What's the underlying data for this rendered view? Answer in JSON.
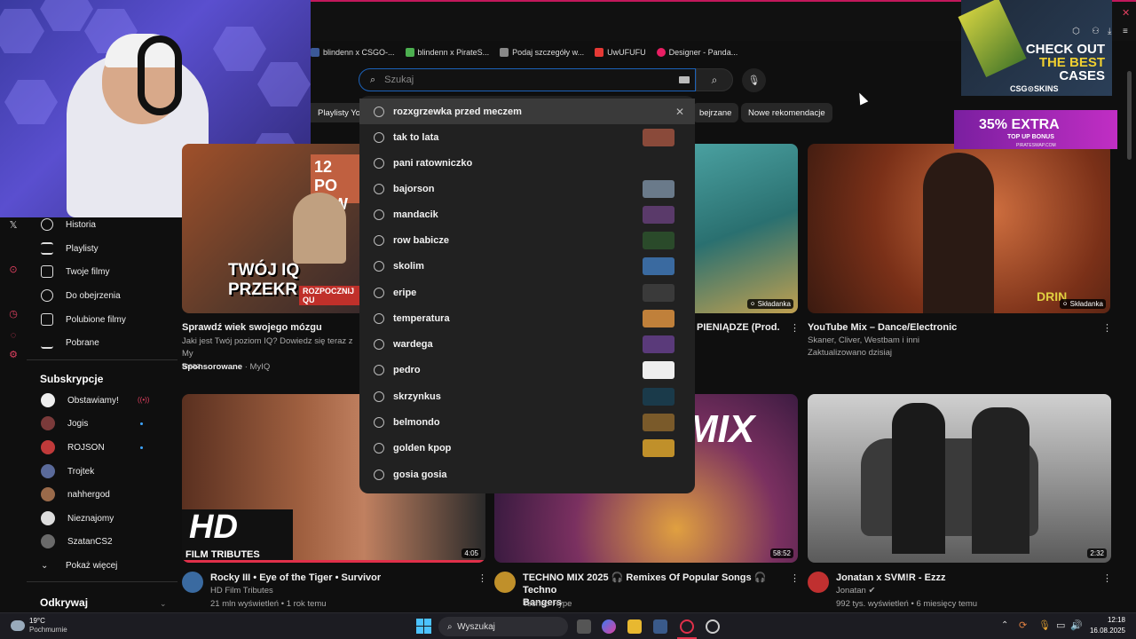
{
  "bookmarks": [
    {
      "label": "blindenn x CSGO-...",
      "color": "#3b5998"
    },
    {
      "label": "blindenn x PirateS...",
      "color": "#4caf50"
    },
    {
      "label": "Podaj szczegóły w...",
      "color": "#888888"
    },
    {
      "label": "UwUFUFU",
      "color": "#e53935"
    },
    {
      "label": "Designer - Panda...",
      "color": "#e91e63"
    }
  ],
  "search": {
    "placeholder": "Szukaj"
  },
  "suggestions": [
    {
      "text": "rozxgrzewka przed meczem",
      "thumb": null
    },
    {
      "text": "tak to lata",
      "thumb": "#8a4a3a"
    },
    {
      "text": "pani ratowniczko",
      "thumb": null
    },
    {
      "text": "bajorson",
      "thumb": "#6a7a8a"
    },
    {
      "text": "mandacik",
      "thumb": "#5a3a6a"
    },
    {
      "text": "row babicze",
      "thumb": "#2a4a2a"
    },
    {
      "text": "skolim",
      "thumb": "#3a6aa0"
    },
    {
      "text": "eripe",
      "thumb": "#3a3a3a"
    },
    {
      "text": "temperatura",
      "thumb": "#c0803a"
    },
    {
      "text": "wardega",
      "thumb": "#5a3a7a"
    },
    {
      "text": "pedro",
      "thumb": "#ffffff"
    },
    {
      "text": "skrzynkus",
      "thumb": "#1a3a4a"
    },
    {
      "text": "belmondo",
      "thumb": "#7a5a2a"
    },
    {
      "text": "golden kpop",
      "thumb": "#c0902a"
    },
    {
      "text": "gosia gosia",
      "thumb": null
    }
  ],
  "chips": {
    "playlisty": "Playlisty YouTube",
    "obejrzane": "bejrzane",
    "nowe": "Nowe rekomendacje"
  },
  "sidebar": {
    "items": [
      {
        "label": "Historia"
      },
      {
        "label": "Playlisty"
      },
      {
        "label": "Twoje filmy"
      },
      {
        "label": "Do obejrzenia"
      },
      {
        "label": "Polubione filmy"
      },
      {
        "label": "Pobrane"
      }
    ],
    "subs_header": "Subskrypcje",
    "subs": [
      {
        "label": "Obstawiamy!",
        "color": "#eeeeee"
      },
      {
        "label": "Jogis",
        "color": "#7a3a3a"
      },
      {
        "label": "ROJSON",
        "color": "#c03a3a"
      },
      {
        "label": "Trojtek",
        "color": "#5a6a9a"
      },
      {
        "label": "nahhergod",
        "color": "#9a6a4a"
      },
      {
        "label": "Nieznajomy",
        "color": "#dddddd"
      },
      {
        "label": "SzatanCS2",
        "color": "#6a6a6a"
      }
    ],
    "more": "Pokaż więcej",
    "explore": "Odkrywaj"
  },
  "videos": {
    "v1": {
      "title": "Sprawdź wiek swojego mózgu",
      "line1": "Jaki jest Twój poziom IQ? Dowiedz się teraz z My",
      "line2": "teraz",
      "sponsor": "Sponsorowane",
      "channel": "· MyIQ",
      "thumb_text1": "12 PO",
      "thumb_text2": "ZI W T",
      "thumb_text3": "TWÓJ IQ PRZEKR",
      "thumb_text4": "ROZPOCZNIJ QU"
    },
    "v2": {
      "title": "PIENIĄDZE (Prod.",
      "badge": "Składanka"
    },
    "v3": {
      "title": "YouTube Mix – Dance/Electronic",
      "meta1": "Skaner, Cliver, Westbam i inni",
      "meta2": "Zaktualizowano dzisiaj",
      "badge": "Składanka",
      "thumb_text": "DRIN"
    },
    "v4": {
      "title": "Rocky III • Eye of the Tiger • Survivor",
      "channel": "HD Film Tributes",
      "meta": "21 mln wyświetleń • 1 rok temu",
      "duration": "4:05",
      "thumb_text1": "HD",
      "thumb_text2": "FILM TRIBUTES"
    },
    "v5": {
      "title": "TECHNO MIX 2025 🎧 Remixes Of Popular Songs 🎧 Techno",
      "title2": "Bangers",
      "channel": "Techno Hype",
      "duration": "58:52",
      "thumb_text": "MIX"
    },
    "v6": {
      "title": "Jonatan x SVM!R - Ezzz",
      "channel": "Jonatan",
      "meta": "992 tys. wyświetleń • 6 miesięcy temu",
      "duration": "2:32"
    }
  },
  "ads": {
    "ad1_line1": "CHECK OUT",
    "ad1_line2": "THE BEST",
    "ad1_line3": "CASES",
    "ad1_brand": "CSG⊙SKINS",
    "ad2_line1": "35% EXTRA",
    "ad2_line2": "TOP UP BONUS",
    "ad2_brand": "PIRATESWAP.COM"
  },
  "taskbar": {
    "temp": "19°C",
    "weather": "Pochmurnie",
    "search": "Wyszukaj",
    "time": "12:18",
    "date": "16.08.2025"
  }
}
